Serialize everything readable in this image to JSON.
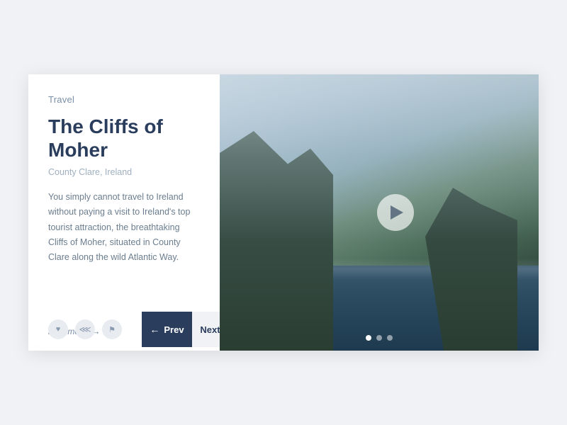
{
  "card": {
    "category": "Travel",
    "title": "The Cliffs of Moher",
    "subtitle": "County Clare, Ireland",
    "body": "You simply cannot travel to Ireland without paying a visit to Ireland's top tourist attraction, the breathtaking Cliffs of Moher, situated in County Clare along the wild Atlantic Way.",
    "read_more_label": "read more",
    "social_icons": [
      {
        "name": "twitter-icon",
        "symbol": "♥"
      },
      {
        "name": "share-icon",
        "symbol": "⟨"
      },
      {
        "name": "bookmark-icon",
        "symbol": "⚑"
      }
    ],
    "nav": {
      "prev_label": "Prev",
      "next_label": "Next"
    },
    "dots": [
      {
        "active": true
      },
      {
        "active": false
      },
      {
        "active": false
      }
    ]
  }
}
